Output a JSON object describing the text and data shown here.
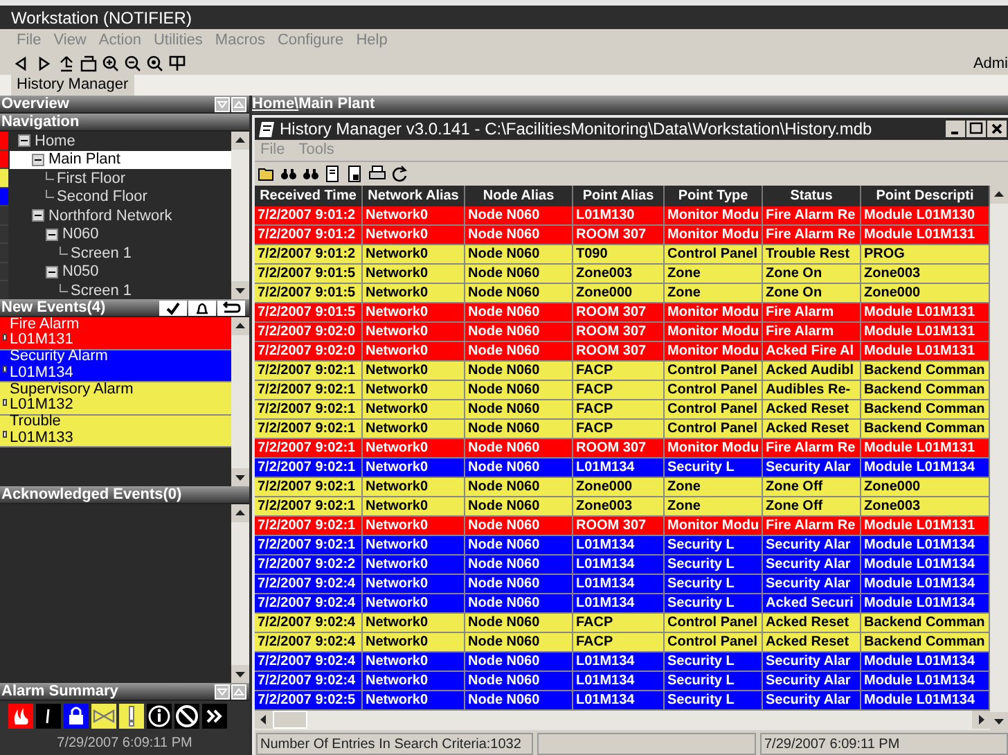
{
  "window": {
    "title": "Workstation (NOTIFIER)"
  },
  "menu": [
    "File",
    "View",
    "Action",
    "Utilities",
    "Macros",
    "Configure",
    "Help"
  ],
  "user": "Admi",
  "tabs": [
    {
      "label": "History Manager",
      "selected": true
    }
  ],
  "overview": {
    "title": "Overview",
    "breadcrumb": {
      "link": "Home\\",
      "current": "Main Plant"
    }
  },
  "navigation": {
    "title": "Navigation",
    "items": [
      {
        "label": "Home",
        "color": "#ff0000",
        "expanded": true,
        "selected": false,
        "children": [
          {
            "label": "Main Plant",
            "color": "#ff0000",
            "expanded": true,
            "selected": true,
            "children": [
              {
                "label": "First Floor",
                "color": "#f0ec50",
                "selected": false
              },
              {
                "label": "Second Floor",
                "color": "#0000ff",
                "selected": false
              }
            ]
          },
          {
            "label": "Northford Network",
            "color": "#333333",
            "expanded": true,
            "selected": false,
            "children": [
              {
                "label": "N060",
                "color": "#333333",
                "expanded": true,
                "selected": false,
                "children": [
                  {
                    "label": "Screen 1",
                    "color": "#333333",
                    "selected": false
                  }
                ]
              },
              {
                "label": "N050",
                "color": "#333333",
                "expanded": true,
                "selected": false,
                "children": [
                  {
                    "label": "Screen 1",
                    "color": "#333333",
                    "selected": false
                  }
                ]
              }
            ]
          }
        ]
      }
    ]
  },
  "new_events": {
    "title": "New Events(4)",
    "items": [
      {
        "type": "Fire Alarm",
        "point": "L01M131",
        "color": "#ff0000"
      },
      {
        "type": "Security Alarm",
        "point": "L01M134",
        "color": "#0000ff"
      },
      {
        "type": "Supervisory Alarm",
        "point": "L01M132",
        "color": "#f0ec50"
      },
      {
        "type": "Trouble",
        "point": "L01M133",
        "color": "#f0ec50"
      }
    ]
  },
  "acknowledged_events": {
    "title": "Acknowledged Events(0)"
  },
  "alarm_summary": {
    "title": "Alarm Summary",
    "timestamp": "7/29/2007 6:09:11 PM"
  },
  "history_window": {
    "title": "History Manager v3.0.141 - C:\\FacilitiesMonitoring\\Data\\Workstation\\History.mdb",
    "menu": [
      "File",
      "Tools"
    ],
    "table": {
      "columns": [
        "Received Time",
        "Network Alias",
        "Node Alias",
        "Point Alias",
        "Point Type",
        "Status",
        "Point Descripti"
      ],
      "rows": [
        {
          "color": "#ff0000",
          "cells": [
            "7/2/2007 9:01:2",
            "Network0",
            "Node N060",
            "L01M130",
            "Monitor Modu",
            "Fire Alarm Re",
            "Module L01M130"
          ]
        },
        {
          "color": "#ff0000",
          "cells": [
            "7/2/2007 9:01:2",
            "Network0",
            "Node N060",
            "ROOM 307",
            "Monitor Modu",
            "Fire Alarm Re",
            "Module L01M131"
          ]
        },
        {
          "color": "#f0ec50",
          "cells": [
            "7/2/2007 9:01:2",
            "Network0",
            "Node N060",
            "T090",
            "Control Panel",
            "Trouble Rest",
            "PROG"
          ]
        },
        {
          "color": "#f0ec50",
          "cells": [
            "7/2/2007 9:01:5",
            "Network0",
            "Node N060",
            "Zone003",
            "Zone",
            "Zone On",
            "Zone003"
          ]
        },
        {
          "color": "#f0ec50",
          "cells": [
            "7/2/2007 9:01:5",
            "Network0",
            "Node N060",
            "Zone000",
            "Zone",
            "Zone On",
            "Zone000"
          ]
        },
        {
          "color": "#ff0000",
          "cells": [
            "7/2/2007 9:01:5",
            "Network0",
            "Node N060",
            "ROOM 307",
            "Monitor Modu",
            "Fire Alarm",
            "Module L01M131"
          ]
        },
        {
          "color": "#ff0000",
          "cells": [
            "7/2/2007 9:02:0",
            "Network0",
            "Node N060",
            "ROOM 307",
            "Monitor Modu",
            "Fire Alarm",
            "Module L01M131"
          ]
        },
        {
          "color": "#ff0000",
          "cells": [
            "7/2/2007 9:02:0",
            "Network0",
            "Node N060",
            "ROOM 307",
            "Monitor Modu",
            "Acked Fire Al",
            "Module L01M131"
          ]
        },
        {
          "color": "#f0ec50",
          "cells": [
            "7/2/2007 9:02:1",
            "Network0",
            "Node N060",
            "FACP",
            "Control Panel",
            "Acked Audibl",
            "Backend Comman"
          ]
        },
        {
          "color": "#f0ec50",
          "cells": [
            "7/2/2007 9:02:1",
            "Network0",
            "Node N060",
            "FACP",
            "Control Panel",
            "Audibles Re-",
            "Backend Comman"
          ]
        },
        {
          "color": "#f0ec50",
          "cells": [
            "7/2/2007 9:02:1",
            "Network0",
            "Node N060",
            "FACP",
            "Control Panel",
            "Acked Reset",
            "Backend Comman"
          ]
        },
        {
          "color": "#f0ec50",
          "cells": [
            "7/2/2007 9:02:1",
            "Network0",
            "Node N060",
            "FACP",
            "Control Panel",
            "Acked Reset",
            "Backend Comman"
          ]
        },
        {
          "color": "#ff0000",
          "cells": [
            "7/2/2007 9:02:1",
            "Network0",
            "Node N060",
            "ROOM 307",
            "Monitor Modu",
            "Fire Alarm Re",
            "Module L01M131"
          ]
        },
        {
          "color": "#0000ff",
          "cells": [
            "7/2/2007 9:02:1",
            "Network0",
            "Node N060",
            "L01M134",
            "Security L",
            "Security Alar",
            "Module L01M134"
          ]
        },
        {
          "color": "#f0ec50",
          "cells": [
            "7/2/2007 9:02:1",
            "Network0",
            "Node N060",
            "Zone000",
            "Zone",
            "Zone Off",
            "Zone000"
          ]
        },
        {
          "color": "#f0ec50",
          "cells": [
            "7/2/2007 9:02:1",
            "Network0",
            "Node N060",
            "Zone003",
            "Zone",
            "Zone Off",
            "Zone003"
          ]
        },
        {
          "color": "#ff0000",
          "cells": [
            "7/2/2007 9:02:1",
            "Network0",
            "Node N060",
            "ROOM 307",
            "Monitor Modu",
            "Fire Alarm Re",
            "Module L01M131"
          ]
        },
        {
          "color": "#0000ff",
          "cells": [
            "7/2/2007 9:02:1",
            "Network0",
            "Node N060",
            "L01M134",
            "Security L",
            "Security Alar",
            "Module L01M134"
          ]
        },
        {
          "color": "#0000ff",
          "cells": [
            "7/2/2007 9:02:2",
            "Network0",
            "Node N060",
            "L01M134",
            "Security L",
            "Security Alar",
            "Module L01M134"
          ]
        },
        {
          "color": "#0000ff",
          "cells": [
            "7/2/2007 9:02:4",
            "Network0",
            "Node N060",
            "L01M134",
            "Security L",
            "Security Alar",
            "Module L01M134"
          ]
        },
        {
          "color": "#0000ff",
          "cells": [
            "7/2/2007 9:02:4",
            "Network0",
            "Node N060",
            "L01M134",
            "Security L",
            "Acked Securi",
            "Module L01M134"
          ]
        },
        {
          "color": "#f0ec50",
          "cells": [
            "7/2/2007 9:02:4",
            "Network0",
            "Node N060",
            "FACP",
            "Control Panel",
            "Acked Reset",
            "Backend Comman"
          ]
        },
        {
          "color": "#f0ec50",
          "cells": [
            "7/2/2007 9:02:4",
            "Network0",
            "Node N060",
            "FACP",
            "Control Panel",
            "Acked Reset",
            "Backend Comman"
          ]
        },
        {
          "color": "#0000ff",
          "cells": [
            "7/2/2007 9:02:4",
            "Network0",
            "Node N060",
            "L01M134",
            "Security L",
            "Security Alar",
            "Module L01M134"
          ]
        },
        {
          "color": "#0000ff",
          "cells": [
            "7/2/2007 9:02:4",
            "Network0",
            "Node N060",
            "L01M134",
            "Security L",
            "Security Alar",
            "Module L01M134"
          ]
        },
        {
          "color": "#0000ff",
          "cells": [
            "7/2/2007 9:02:5",
            "Network0",
            "Node N060",
            "L01M134",
            "Security L",
            "Security Alar",
            "Module L01M134"
          ]
        }
      ]
    },
    "status_bar": [
      "Number Of Entries In Search Criteria:1032",
      "7/29/2007 6:09:11 PM"
    ]
  }
}
